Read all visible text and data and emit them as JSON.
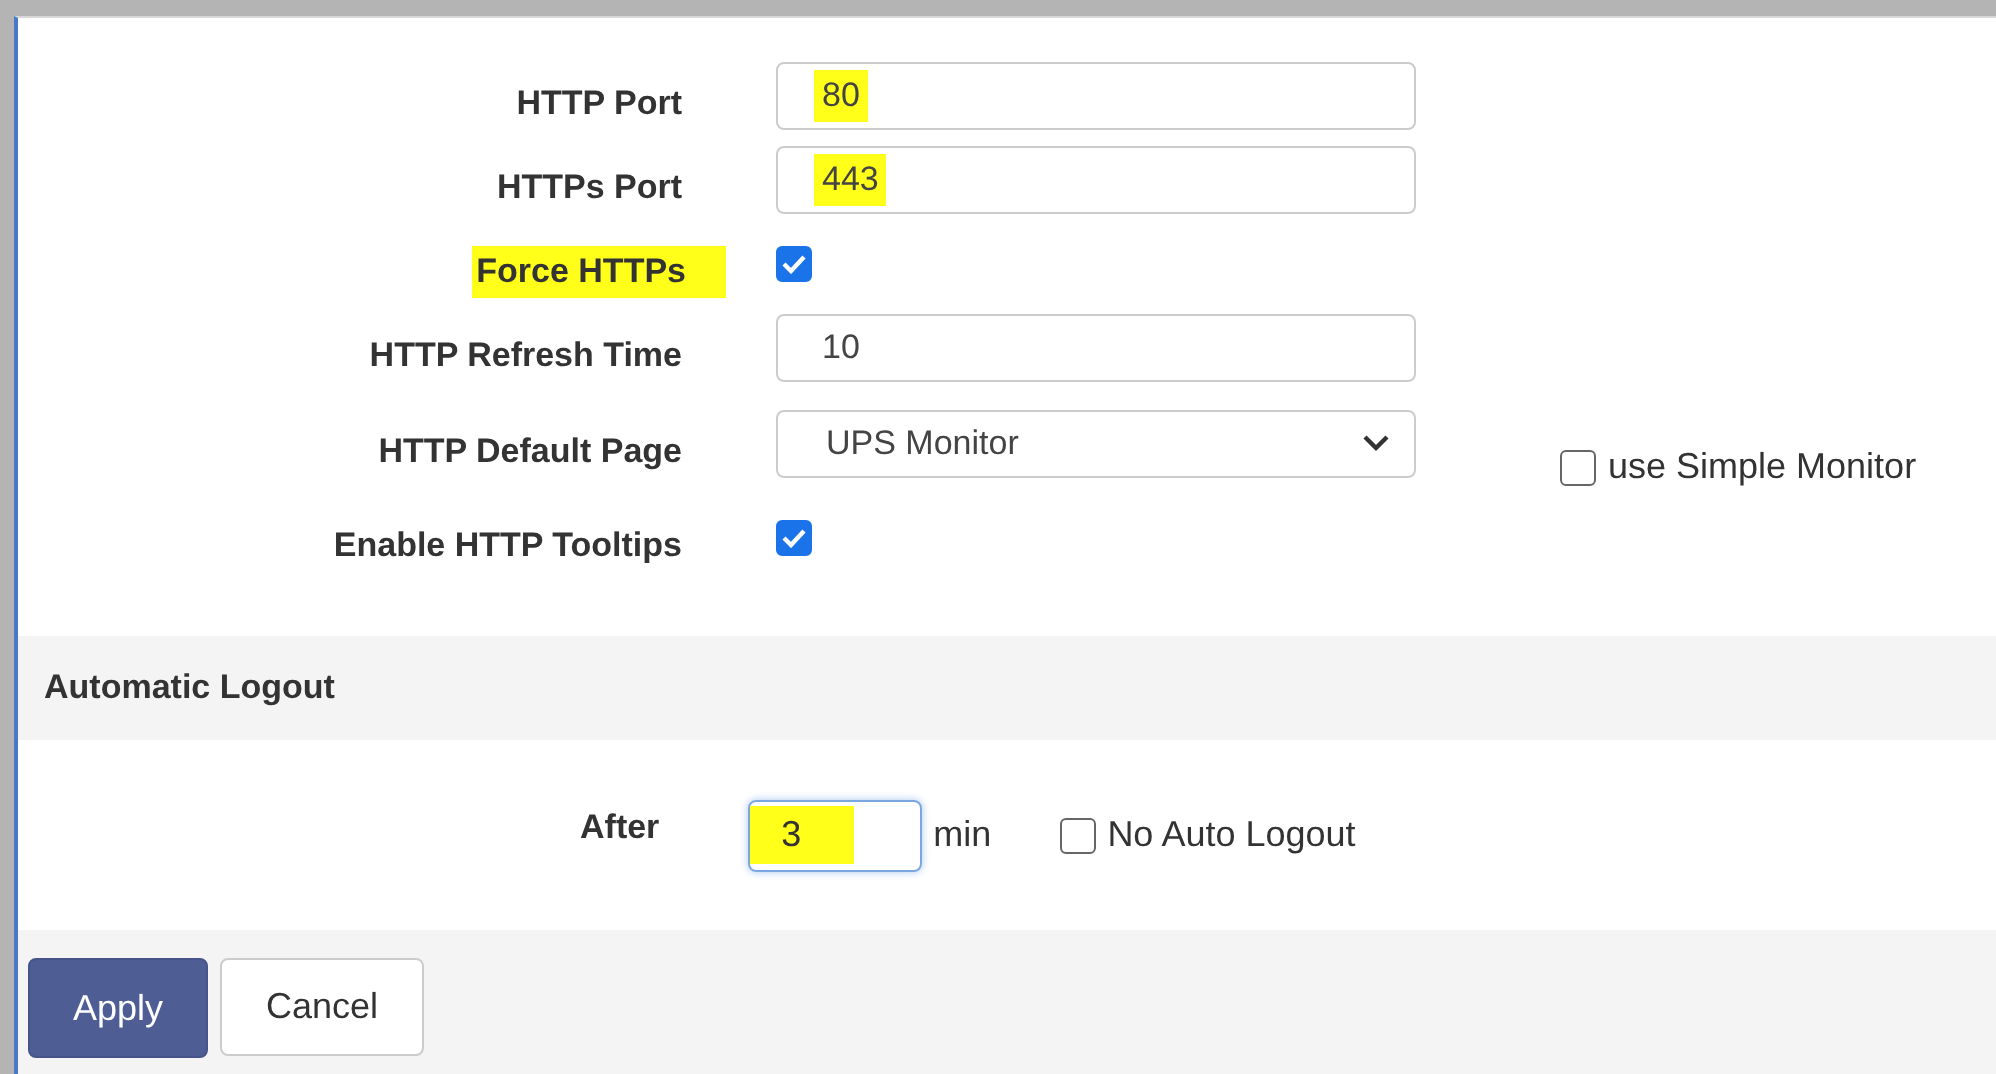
{
  "settings": [
    {
      "kind": "text",
      "label": "HTTP Port",
      "value": "80",
      "value_highlighted": true
    },
    {
      "kind": "text",
      "label": "HTTPs Port",
      "value": "443",
      "value_highlighted": true
    },
    {
      "kind": "checkbox",
      "label": "Force HTTPs",
      "checked": true,
      "label_highlighted": true
    },
    {
      "kind": "text",
      "label": "HTTP Refresh Time",
      "value": "10",
      "value_highlighted": false
    },
    {
      "kind": "select",
      "label": "HTTP Default Page",
      "value": "UPS Monitor",
      "side_option": {
        "label": "use Simple Monitor",
        "checked": false
      }
    },
    {
      "kind": "checkbox",
      "label": "Enable HTTP Tooltips",
      "checked": true,
      "label_highlighted": false
    }
  ],
  "logout_section": {
    "title": "Automatic Logout",
    "label": "After",
    "value": "3",
    "value_highlighted": true,
    "unit": "min",
    "option": {
      "label": "No Auto Logout",
      "checked": false
    }
  },
  "buttons": [
    {
      "label": "Apply",
      "kind": "primary"
    },
    {
      "label": "Cancel",
      "kind": "secondary"
    }
  ]
}
